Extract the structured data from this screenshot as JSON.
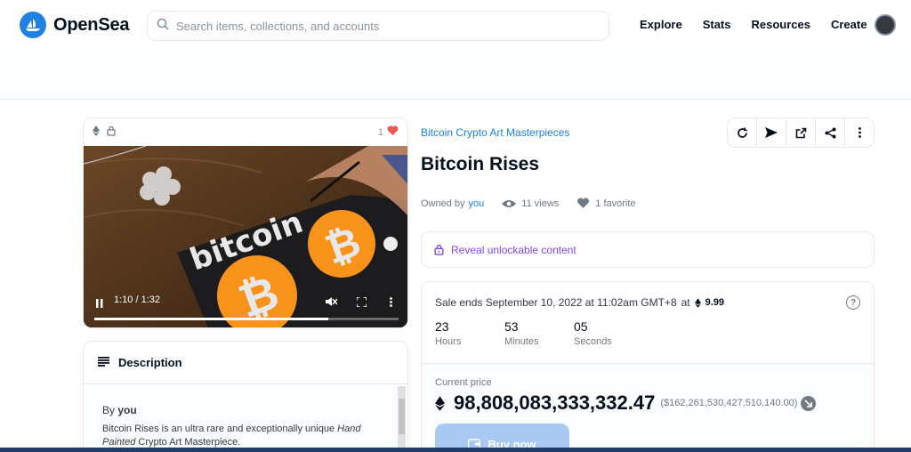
{
  "brand": {
    "name": "OpenSea",
    "color": "#2081e2"
  },
  "search": {
    "placeholder": "Search items, collections, and accounts"
  },
  "nav": {
    "items": [
      "Explore",
      "Stats",
      "Resources",
      "Create"
    ]
  },
  "media": {
    "favorites_count": "1",
    "video": {
      "time": "1:10 / 1:32",
      "progress": 0.77
    }
  },
  "description": {
    "title": "Description",
    "by_prefix": "By",
    "by_name": "you",
    "text_part1": "Bitcoin Rises",
    "text_part2": " is an ultra rare and exceptionally unique ",
    "text_part3": "Hand Painted",
    "text_part4": " Crypto Art Masterpiece."
  },
  "item": {
    "collection": "Bitcoin Crypto Art Masterpieces",
    "title": "Bitcoin Rises",
    "owned_prefix": "Owned by",
    "owner": "you",
    "views": "11 views",
    "favorites": "1 favorite"
  },
  "unlockable": {
    "label": "Reveal unlockable content"
  },
  "sale": {
    "ends_text": "Sale ends September 10, 2022 at 11:02am GMT+8",
    "at": "at",
    "min_price": "9.99",
    "countdown": [
      {
        "value": "23",
        "label": "Hours"
      },
      {
        "value": "53",
        "label": "Minutes"
      },
      {
        "value": "05",
        "label": "Seconds"
      }
    ],
    "current_price_label": "Current price",
    "price": "98,808,083,333,332.47",
    "usd": "($162,261,530,427,510,140.00)",
    "buy_label": "Buy now"
  }
}
